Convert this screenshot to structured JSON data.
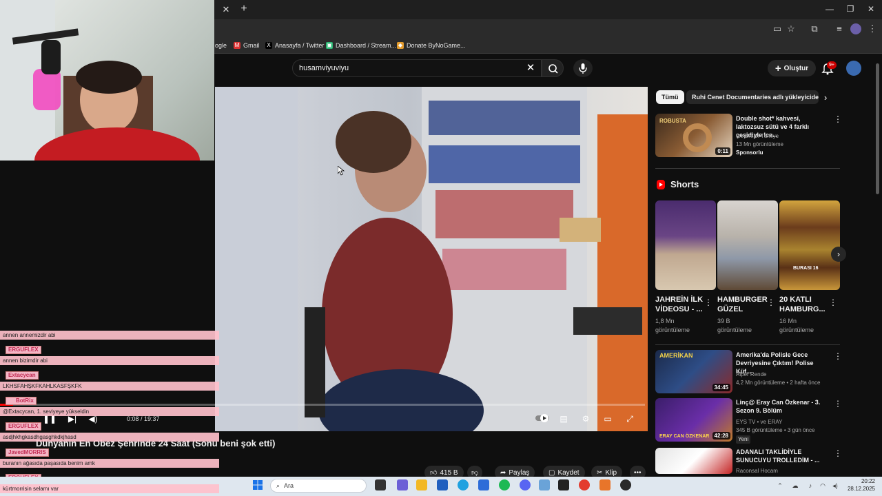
{
  "browser": {
    "tab_close_glyph": "✕",
    "new_tab_glyph": "+",
    "window_controls": [
      "—",
      "❐",
      "✕"
    ],
    "bookmarks": [
      {
        "label": "ogle",
        "icon": "google-icon"
      },
      {
        "label": "Gmail",
        "icon": "gmail-icon"
      },
      {
        "label": "Anasayfa / Twitter",
        "icon": "x-icon"
      },
      {
        "label": "Dashboard / Stream...",
        "icon": "dashboard-icon"
      },
      {
        "label": "Donate ByNoGame...",
        "icon": "bynogame-icon"
      }
    ]
  },
  "youtube": {
    "search": {
      "value": "husamviyuviyu",
      "clear_glyph": "✕"
    },
    "create_label": "Oluştur",
    "notification_badge": "9+",
    "video": {
      "title": "Dünyanın En Obez Şehrinde 24 Saat (Sonu beni şok etti)",
      "time": "0:08 / 19:37",
      "progress_fraction": 0.02,
      "actions": {
        "likes": "415 B",
        "share": "Paylaş",
        "save": "Kaydet",
        "clip": "Klip",
        "more": "•••"
      }
    },
    "chips": [
      {
        "label": "Tümü",
        "active": true
      },
      {
        "label": "Ruhi Cenet Documentaries adlı yükleyiciden",
        "active": false
      }
    ],
    "sponsored": {
      "title": "Double shot* kahvesi, laktozsuz sütü ve 4 farklı çeşidiyle Ice...",
      "channel": "Ice Break Türkiye",
      "views": "13 Mn görüntüleme",
      "badge": "Sponsorlu",
      "thumb_text": "ROBUSTA",
      "duration": "0:11"
    },
    "shorts_title": "Shorts",
    "shorts": [
      {
        "title": "JAHREİN İLK VİDEOSU - ...",
        "views": "1,8 Mn görüntüleme"
      },
      {
        "title": "HAMBURGER GÜZEL",
        "views": "39 B görüntüleme"
      },
      {
        "title": "20 KATLI HAMBURG...",
        "views": "16 Mn görüntüleme"
      }
    ],
    "short3_thumb_text": "BURASI 16",
    "recommended": [
      {
        "title": "Amerika'da Polisle Gece Devriyesine Çıktım! Polise Küf...",
        "channel": "Alper Rende",
        "meta": "4,2 Mn görüntüleme • 2 hafta önce",
        "duration": "34:45",
        "badge": "",
        "thumb_text": "AMERİKAN"
      },
      {
        "title": "Linç@ Eray Can Özkenar - 3. Sezon 9. Bölüm",
        "channel": "EYS TV • ve ERAY",
        "meta": "345 B görüntüleme • 3 gün önce",
        "duration": "42:28",
        "badge": "Yeni",
        "thumb_text": "ERAY CAN ÖZKENAR"
      },
      {
        "title": "ADANALI TAKLİDİYLE SUNUCUYU TROLLEDİM - ...",
        "channel": "Raconsal Hocam",
        "meta": "",
        "duration": "",
        "badge": "",
        "thumb_text": ""
      }
    ]
  },
  "chat": [
    {
      "name": "",
      "text": "annen annemizdir abi"
    },
    {
      "name": "ERGUFLEX",
      "text": ""
    },
    {
      "name": "",
      "text": "annen bizimdir abi"
    },
    {
      "name": "Extacycan",
      "text": ""
    },
    {
      "name": "",
      "text": "LKHSFAHŞKFKAHLKASFŞKFK"
    },
    {
      "name": "BotRix",
      "text": ""
    },
    {
      "name": "",
      "text": "@Extacycan, 1. seviyeye yükseldin"
    },
    {
      "name": "ERGUFLEX",
      "text": ""
    },
    {
      "name": "",
      "text": "asdjhkhgkasdhgasghkdkjhasd"
    },
    {
      "name": "JavedMORRIS",
      "text": ""
    },
    {
      "name": "",
      "text": "buranın ağasıda paşasıda benim amk"
    },
    {
      "name": "ERGUFLEX",
      "text": ""
    },
    {
      "name": "",
      "text": "kürtmorrisin selamı var"
    }
  ],
  "taskbar": {
    "search_placeholder": "Ara",
    "time": "20:22",
    "date": "28.12.2025"
  },
  "colors": {
    "accent_red": "#ff0000",
    "chat_pink": "#ffc0cb",
    "bg_dark": "#0f0f0f"
  }
}
